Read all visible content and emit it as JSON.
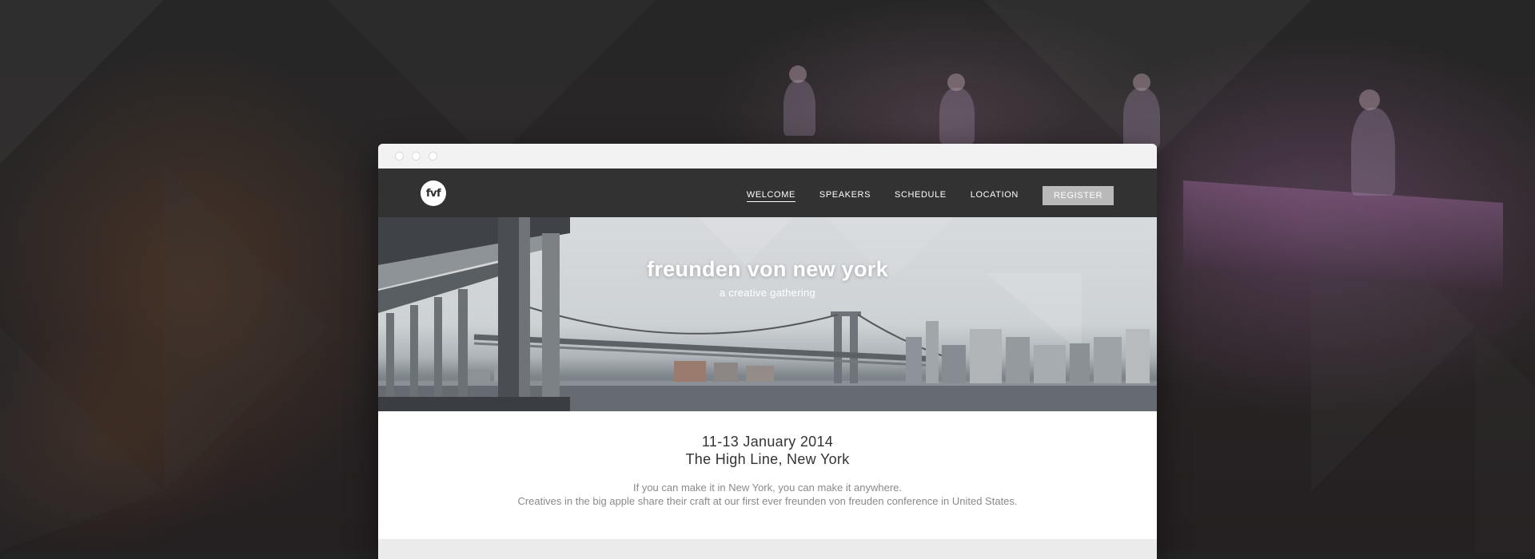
{
  "browser": {
    "nav": {
      "logo_text": "fvf",
      "items": [
        {
          "label": "WELCOME",
          "active": true
        },
        {
          "label": "SPEAKERS",
          "active": false
        },
        {
          "label": "SCHEDULE",
          "active": false
        },
        {
          "label": "LOCATION",
          "active": false
        }
      ],
      "register_label": "REGISTER"
    },
    "hero": {
      "title": "freunden von new york",
      "subtitle": "a creative gathering"
    },
    "info": {
      "date": "11-13 January 2014",
      "venue": "The High Line, New York",
      "lead": "If you can make it in New York, you can make it anywhere.",
      "description": "Creatives in the big apple share their craft at our first ever freunden von freuden conference in United States."
    }
  },
  "colors": {
    "navbar": "#323232",
    "register_button": "#b9b9b9",
    "text_dark": "#333333",
    "text_muted": "#8a8a8a"
  }
}
